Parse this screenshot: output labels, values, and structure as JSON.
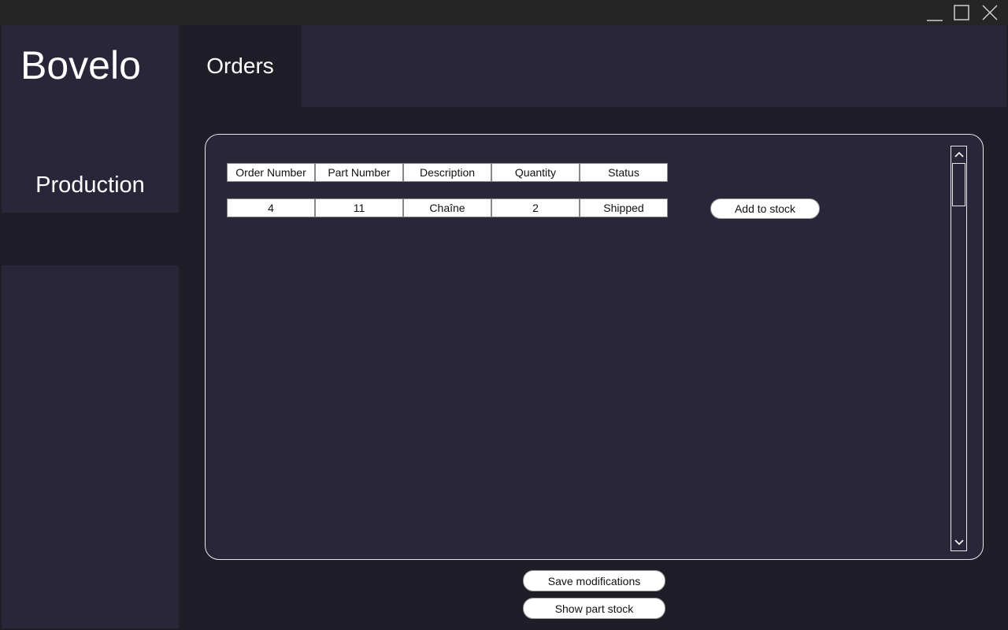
{
  "window": {
    "controls": [
      "minimize-icon",
      "maximize-icon",
      "close-icon"
    ]
  },
  "app": {
    "brand": "Bovelo"
  },
  "nav": {
    "production_label": "Production"
  },
  "tabs": {
    "orders_label": "Orders"
  },
  "table": {
    "headers": [
      "Order Number",
      "Part Number",
      "Description",
      "Quantity",
      "Status"
    ],
    "rows": [
      {
        "order_number": "4",
        "part_number": "11",
        "description": "Chaîne",
        "quantity": "2",
        "status": "Shipped",
        "action_label": "Add to stock"
      }
    ]
  },
  "footer": {
    "save_label": "Save modifications",
    "show_stock_label": "Show part stock"
  },
  "colors": {
    "background": "#1f1e28",
    "panel": "#292639",
    "titlebar": "#252525",
    "text": "#ffffff"
  }
}
